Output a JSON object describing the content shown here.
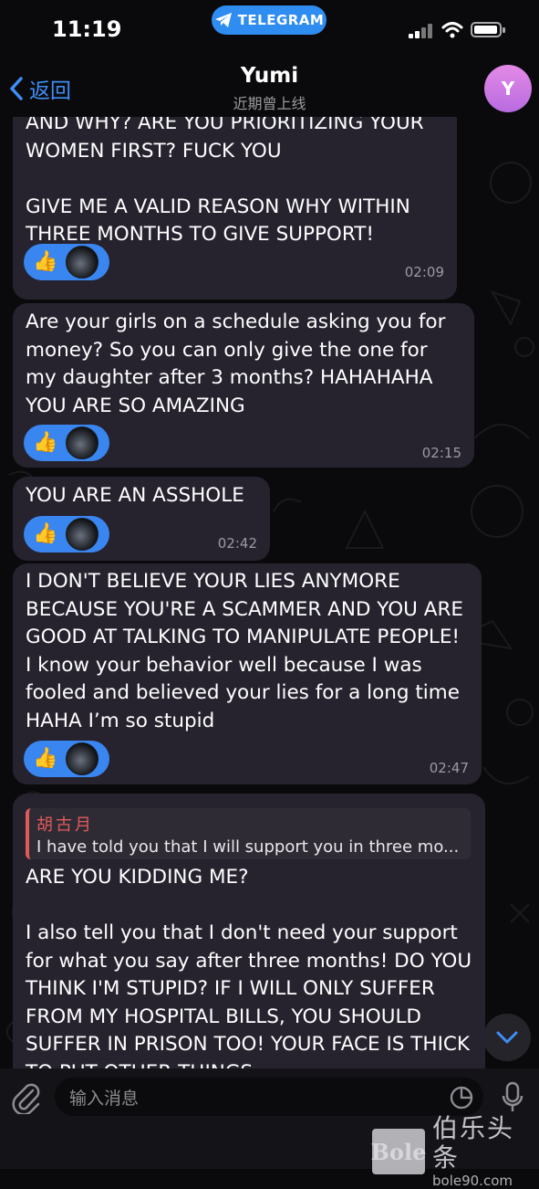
{
  "status_bar": {
    "time": "11:19",
    "pill_label": "TELEGRAM"
  },
  "header": {
    "back_label": "返回",
    "name": "Yumi",
    "status": "近期曾上线",
    "avatar_letter": "Y"
  },
  "messages": [
    {
      "text": "AND WHY? ARE YOU PRIORITIZING YOUR WOMEN FIRST? FUCK YOU\n\nGIVE ME A VALID REASON WHY WITHIN THREE MONTHS TO GIVE SUPPORT!",
      "time": "02:09",
      "reaction": "👍"
    },
    {
      "text": "Are your girls on a schedule asking you for money? So you can only give the one for my daughter after 3 months? HAHAHAHA YOU ARE SO AMAZING",
      "time": "02:15",
      "reaction": "👍"
    },
    {
      "text": "YOU ARE AN ASSHOLE",
      "time": "02:42",
      "reaction": "👍"
    },
    {
      "text": "I DON'T BELIEVE YOUR LIES ANYMORE BECAUSE YOU'RE A SCAMMER AND YOU ARE GOOD AT TALKING TO MANIPULATE PEOPLE! I know your behavior well because I was fooled and believed your lies for a long time HAHA I’m so stupid",
      "time": "02:47",
      "reaction": "👍"
    },
    {
      "reply_name": "胡古月",
      "reply_text": "I have told you that I will support you in three mo...",
      "text": "ARE YOU KIDDING ME?\n\nI also tell you that I don't need your support for what you say after three months! DO YOU THINK I'M STUPID? IF I WILL ONLY SUFFER FROM MY HOSPITAL BILLS, YOU SHOULD SUFFER IN PRISON TOO! YOUR FACE IS THICK TO PUT OTHER THINGS"
    }
  ],
  "input": {
    "placeholder": "输入消息"
  },
  "watermark": {
    "logo": "Bole",
    "name": "伯乐头条",
    "url": "bole90.com"
  },
  "colors": {
    "accent": "#3e8ef7",
    "bubble": "#26232f",
    "reaction": "#3a86f0",
    "reply_accent": "#e05a5a"
  }
}
